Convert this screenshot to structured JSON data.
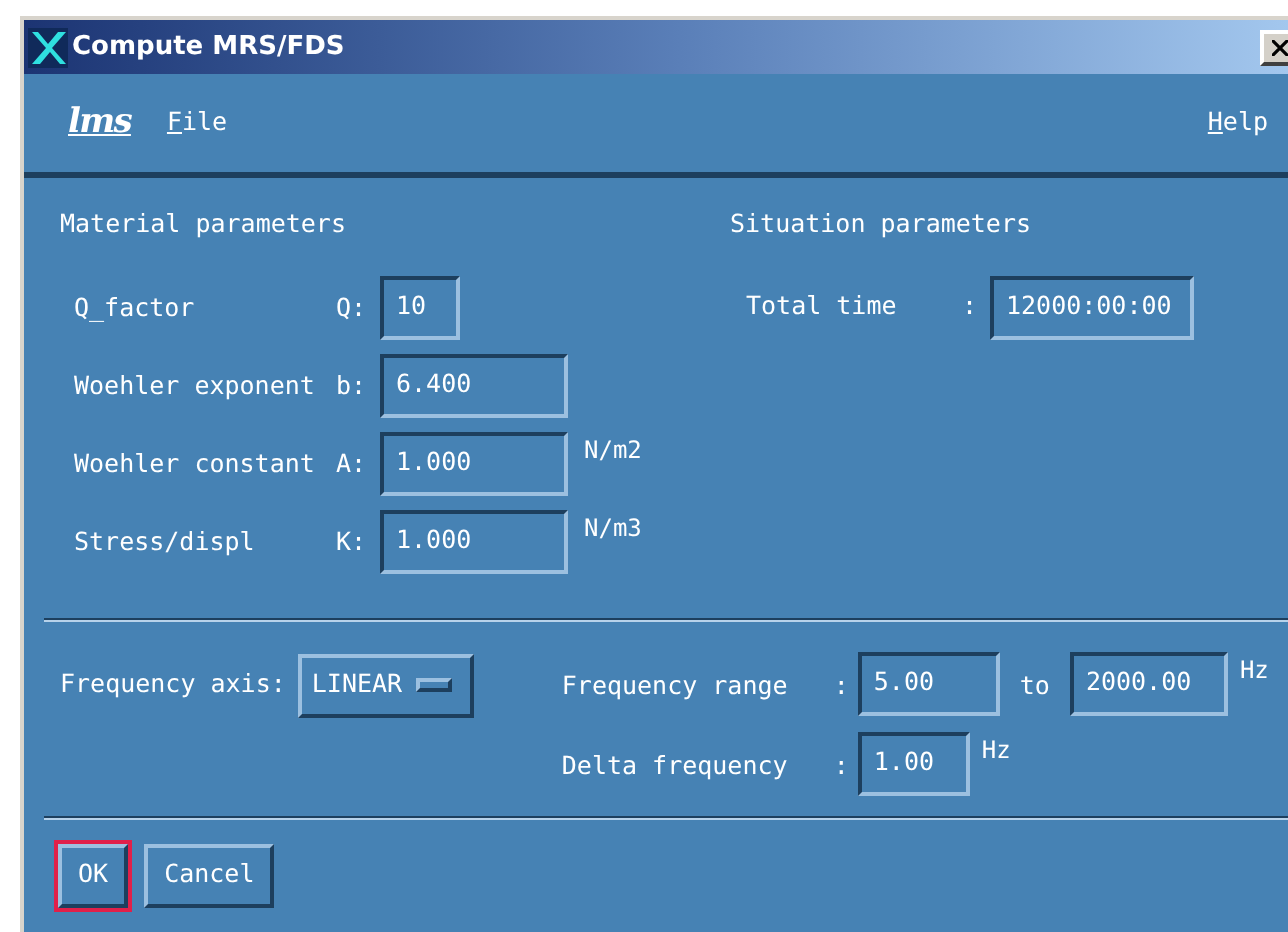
{
  "window": {
    "title": "Compute MRS/FDS"
  },
  "menu": {
    "logo": "lms",
    "items": [
      {
        "label": "File",
        "mnemonic": true
      },
      {
        "label": "Help",
        "mnemonic": true
      }
    ]
  },
  "material": {
    "title": "Material parameters",
    "rows": [
      {
        "label": "Q_factor",
        "symbol": "Q:",
        "value": "10",
        "kind": "short"
      },
      {
        "label": "Woehler exponent",
        "symbol": "b:",
        "value": "6.400",
        "kind": "long"
      },
      {
        "label": "Woehler constant",
        "symbol": "A:",
        "value": "1.000",
        "unit": "N/m2",
        "kind": "long"
      },
      {
        "label": "Stress/displ",
        "symbol": "K:",
        "value": "1.000",
        "unit": "N/m3",
        "kind": "long"
      }
    ]
  },
  "situation": {
    "title": "Situation parameters",
    "total_time": {
      "label": "Total time",
      "separator": ":",
      "value": "12000:00:00"
    }
  },
  "frequency": {
    "axis": {
      "label": "Frequency axis:",
      "value": "LINEAR"
    },
    "range": {
      "label": "Frequency range",
      "separator": ":",
      "from": "5.00",
      "connector": "to",
      "to": "2000.00",
      "unit": "Hz"
    },
    "delta": {
      "label": "Delta frequency",
      "separator": ":",
      "value": "1.00",
      "unit": "Hz"
    }
  },
  "buttons": [
    {
      "label": "OK",
      "selected": true
    },
    {
      "label": "Cancel",
      "selected": false
    }
  ]
}
